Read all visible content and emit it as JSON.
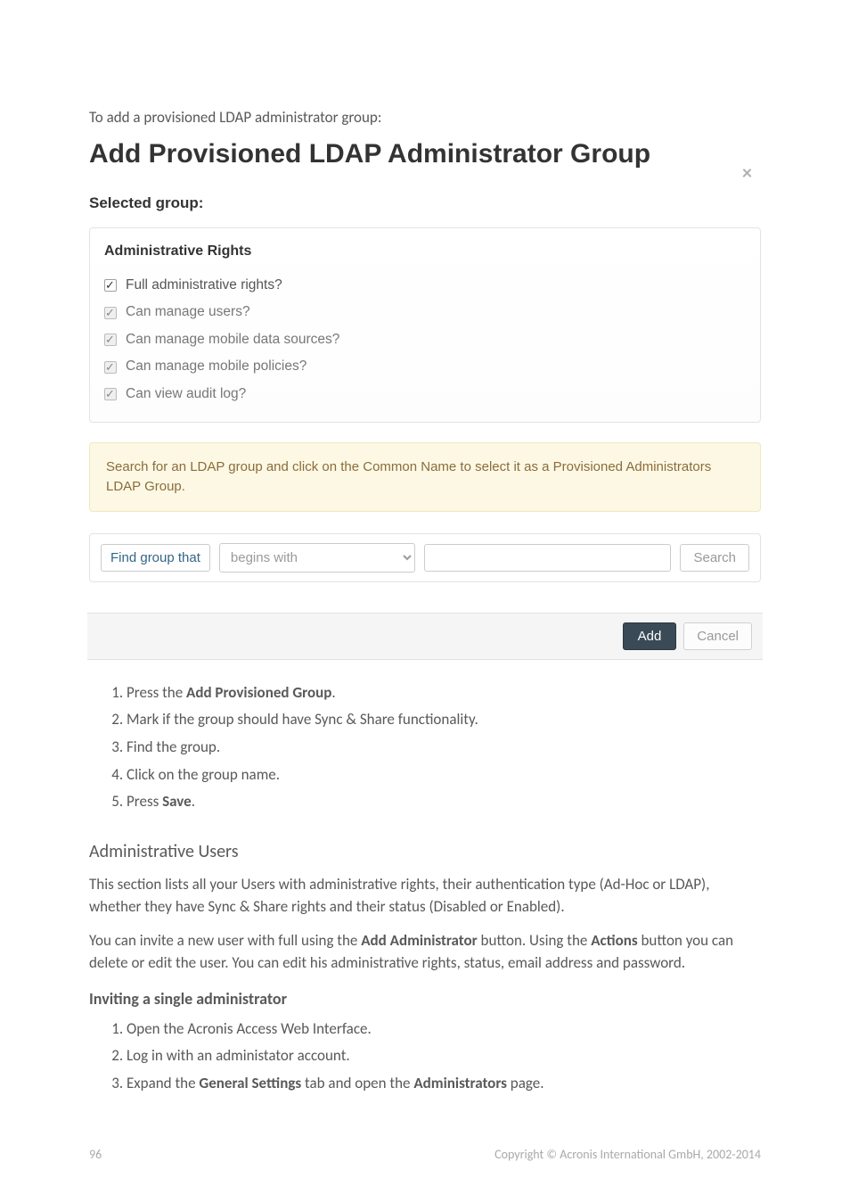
{
  "intro": "To add a provisioned LDAP administrator group:",
  "modal": {
    "title": "Add Provisioned LDAP Administrator Group",
    "close": "×",
    "selected_group_label": "Selected group:",
    "rights_title": "Administrative Rights",
    "rights": [
      {
        "label": "Full administrative rights?",
        "disabled": false
      },
      {
        "label": "Can manage users?",
        "disabled": true
      },
      {
        "label": "Can manage mobile data sources?",
        "disabled": true
      },
      {
        "label": "Can manage mobile policies?",
        "disabled": true
      },
      {
        "label": "Can view audit log?",
        "disabled": true
      }
    ],
    "info": "Search for an LDAP group and click on the Common Name to select it as a Provisioned Administrators LDAP Group.",
    "find_label": "Find group that",
    "criteria_options": [
      "begins with"
    ],
    "criteria_selected": "begins with",
    "search_value": "",
    "search_btn": "Search",
    "add_btn": "Add",
    "cancel_btn": "Cancel"
  },
  "steps1": [
    {
      "pre": "Press the ",
      "bold": "Add Provisioned Group",
      "post": "."
    },
    {
      "pre": "Mark if the group should have Sync & Share functionality.",
      "bold": "",
      "post": ""
    },
    {
      "pre": "Find the group.",
      "bold": "",
      "post": ""
    },
    {
      "pre": "Click on the group name.",
      "bold": "",
      "post": ""
    },
    {
      "pre": "Press ",
      "bold": "Save",
      "post": "."
    }
  ],
  "admin_users": {
    "heading": "Administrative Users",
    "p1": "This section lists all your Users with administrative rights, their authentication type (Ad-Hoc or LDAP), whether they have Sync & Share rights and their status (Disabled or Enabled).",
    "p2_pre": "You can invite a new user with full using the ",
    "p2_b1": "Add Administrator",
    "p2_mid": " button. Using the ",
    "p2_b2": "Actions",
    "p2_post": " button you can delete or edit the user. You can edit his administrative rights, status, email address and password."
  },
  "inviting": {
    "heading": "Inviting a single administrator",
    "steps": [
      {
        "pre": "Open the Acronis Access Web Interface.",
        "bold": "",
        "post": ""
      },
      {
        "pre": "Log in with an administator account.",
        "bold": "",
        "post": ""
      },
      {
        "pre": "Expand the ",
        "bold": "General Settings",
        "mid": " tab and open the ",
        "bold2": "Administrators",
        "post": " page."
      }
    ]
  },
  "footer": {
    "page": "96",
    "copyright": "Copyright © Acronis International GmbH, 2002-2014"
  }
}
